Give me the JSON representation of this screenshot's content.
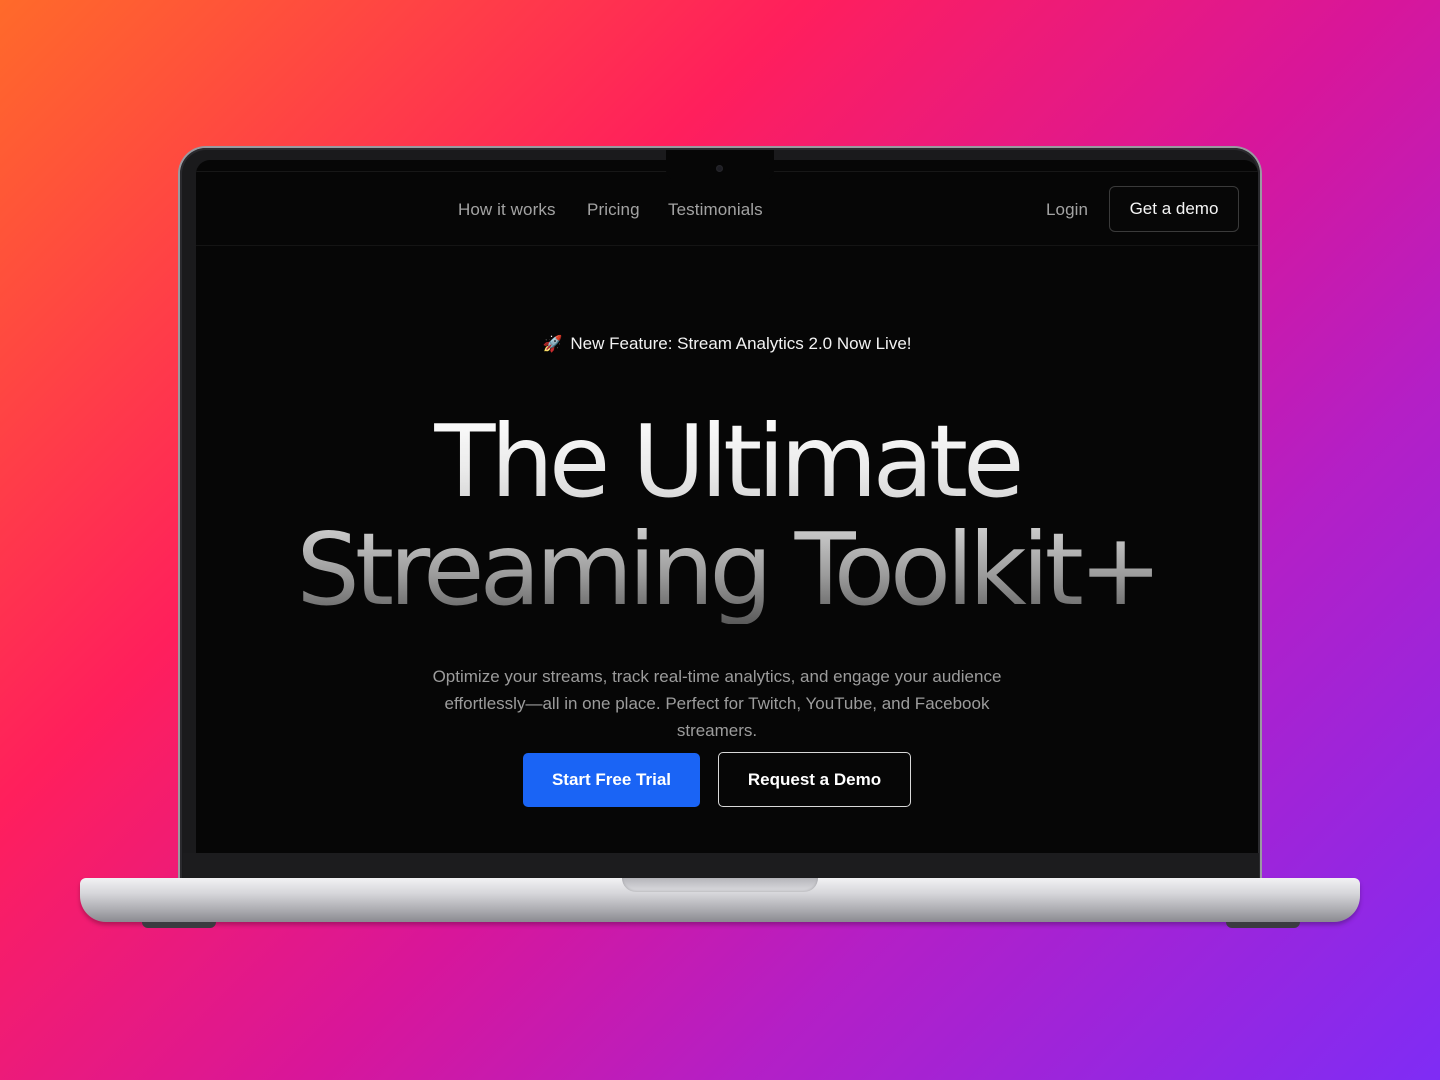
{
  "nav": {
    "links": [
      "How it works",
      "Pricing",
      "Testimonials"
    ],
    "login": "Login",
    "demo_button": "Get a demo"
  },
  "announcement": {
    "icon": "rocket-icon",
    "text": "New Feature: Stream Analytics 2.0 Now Live!"
  },
  "hero": {
    "title_line1": "The Ultimate",
    "title_line2": "Streaming Toolkit+",
    "subtitle": "Optimize your streams, track real-time analytics, and engage your audience effortlessly—all in one place. Perfect for Twitch, YouTube, and Facebook streamers.",
    "primary_cta": "Start Free Trial",
    "secondary_cta": "Request a Demo"
  },
  "colors": {
    "accent": "#1a64f5",
    "screen_bg": "#060606",
    "backdrop_start": "#ff6a2a",
    "backdrop_mid": "#ff1f5c",
    "backdrop_end": "#7f2cf5"
  }
}
